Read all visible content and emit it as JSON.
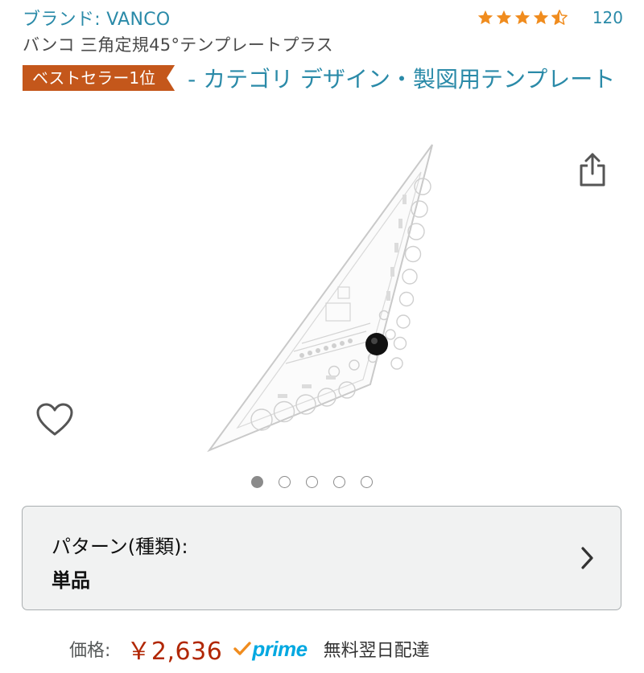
{
  "brand": {
    "link_text": "ブランド: VANCO"
  },
  "rating": {
    "stars": 4.5,
    "count": "120",
    "star_color": "#f08c1e"
  },
  "product": {
    "title": "バンコ 三角定規45°テンプレートプラス"
  },
  "best_seller": {
    "badge": "ベストセラー1位",
    "category": "- カテゴリ デザイン・製図用テンプレート",
    "badge_color": "#c4571b"
  },
  "image_icons": {
    "share": "share-icon",
    "wishlist": "heart-icon"
  },
  "carousel": {
    "total": 5,
    "active_index": 0
  },
  "variant": {
    "label": "パターン(種類):",
    "value": "単品"
  },
  "price": {
    "label": "価格:",
    "value": "￥2,636",
    "prime": "prime",
    "delivery": "無料翌日配達",
    "price_color": "#b12704",
    "prime_color": "#00a8e1"
  }
}
